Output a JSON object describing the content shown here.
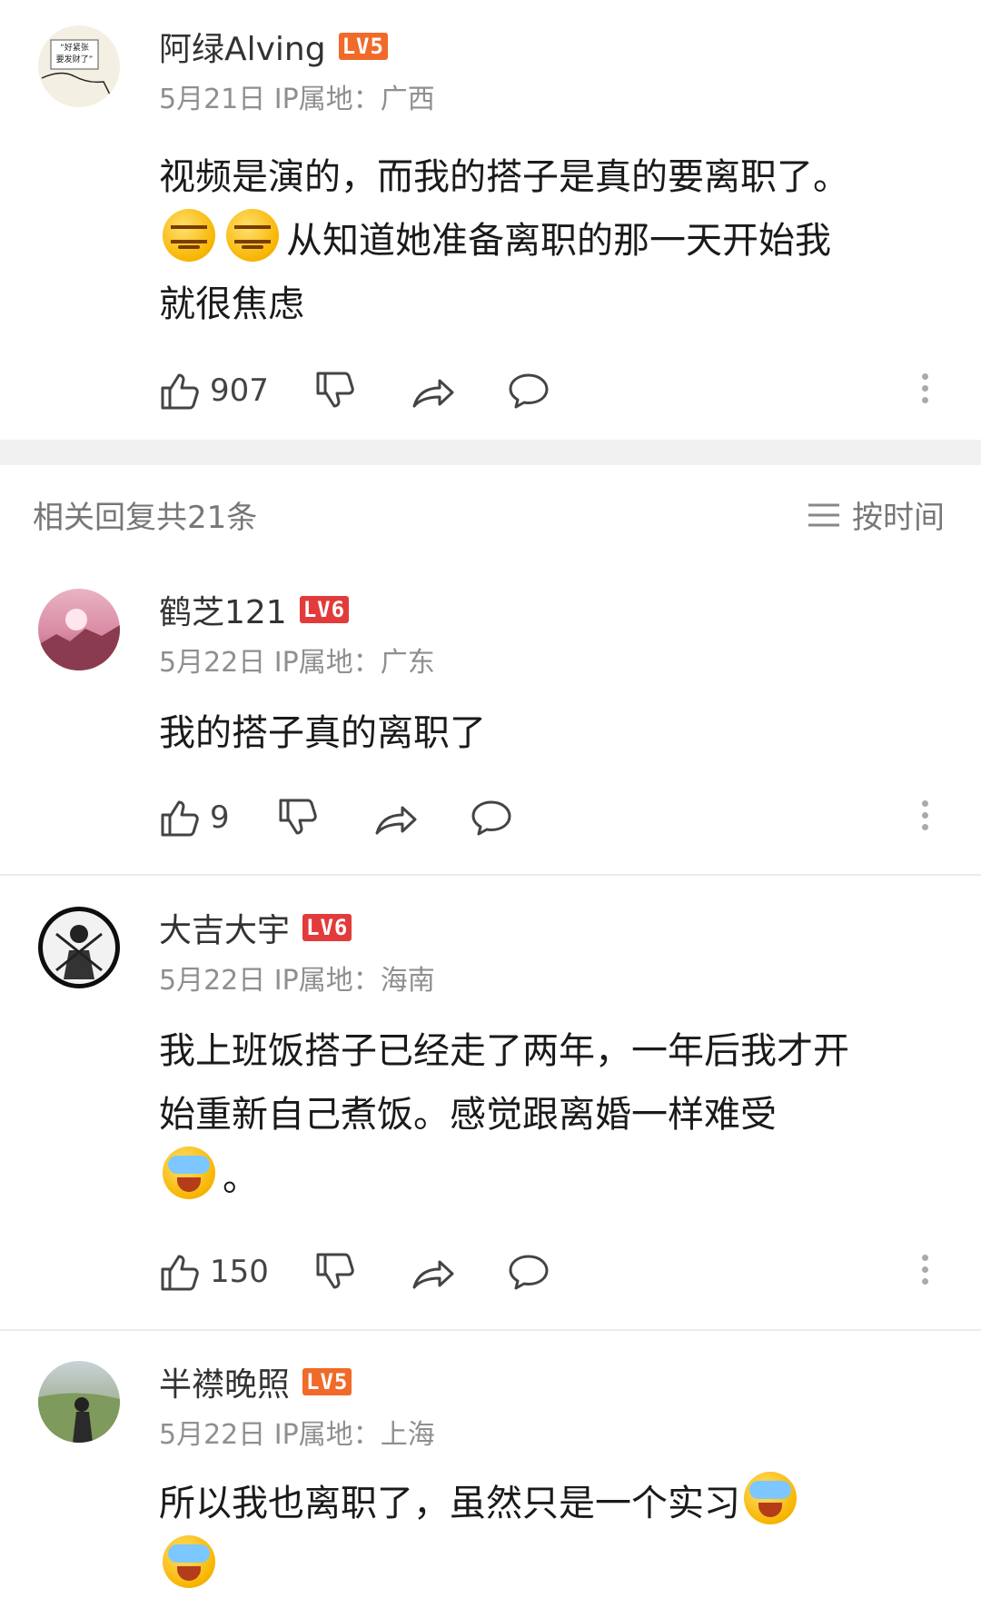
{
  "comments": [
    {
      "name": "阿绿Alving",
      "level": "LV5",
      "level_color": "#f06a2a",
      "meta": "5月21日 IP属地：广西",
      "text_1": "视频是演的，而我的搭子是真的要离职了。",
      "text_2": "从知道她准备离职的那一天开始我",
      "text_3": "就很焦虑",
      "avatar_line1": "“好紧张",
      "avatar_line2": "要发财了”",
      "likes": "907"
    }
  ],
  "replies_header": {
    "count_label": "相关回复共21条",
    "sort_label": "按时间"
  },
  "replies": [
    {
      "name": "鹤芝121",
      "level": "LV6",
      "level_color": "#e23b3b",
      "meta": "5月22日 IP属地：广东",
      "text": "我的搭子真的离职了",
      "likes": "9"
    },
    {
      "name": "大吉大宇",
      "level": "LV6",
      "level_color": "#e23b3b",
      "meta": "5月22日 IP属地：海南",
      "text_1": "我上班饭搭子已经走了两年，一年后我才开",
      "text_2": "始重新自己煮饭。感觉跟离婚一样难受",
      "text_3": "。",
      "likes": "150"
    },
    {
      "name": "半襟晚照",
      "level": "LV5",
      "level_color": "#f06a2a",
      "meta": "5月22日 IP属地：上海",
      "text_1": "所以我也离职了，虽然只是一个实习"
    }
  ]
}
